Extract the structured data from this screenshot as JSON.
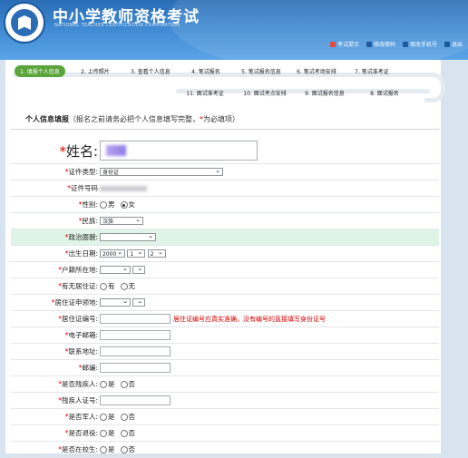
{
  "header": {
    "title": "中小学教师资格考试",
    "subtitle": "NATIONAL TEACHER CERTIFICATION EXAMINATION",
    "links": [
      {
        "label": "考试提示",
        "icon": "alert-icon",
        "color": "#e04a3a"
      },
      {
        "label": "修改密码",
        "icon": "key-icon",
        "color": "#2a6db6"
      },
      {
        "label": "修改手机号",
        "icon": "phone-icon",
        "color": "#2a6db6"
      },
      {
        "label": "退出",
        "icon": "exit-icon",
        "color": "#2a6db6"
      }
    ]
  },
  "steps_row1": [
    {
      "label": "1. 填报个人信息",
      "active": true
    },
    {
      "label": "2. 上传照片",
      "active": false
    },
    {
      "label": "3. 查看个人信息",
      "active": false
    },
    {
      "label": "4. 笔试报名",
      "active": false
    },
    {
      "label": "5. 笔试报名信息",
      "active": false
    },
    {
      "label": "6. 笔试考场安排",
      "active": false
    },
    {
      "label": "7. 笔试准考证",
      "active": false
    }
  ],
  "steps_row2": [
    {
      "label": "11. 面试准考证"
    },
    {
      "label": "10. 面试考点安排"
    },
    {
      "label": "9. 面试报名信息"
    },
    {
      "label": "8. 面试报名"
    }
  ],
  "form_header": {
    "title": "个人信息填报",
    "hint": "（报名之前请务必把个人信息填写完整，",
    "hint_star": "*",
    "hint_end": "为必填项）"
  },
  "fields": {
    "name": {
      "label": "姓名:"
    },
    "id_type": {
      "label": "证件类型:",
      "value": "身份证"
    },
    "id_number": {
      "label": "证件号码"
    },
    "gender": {
      "label": "性别:",
      "options": [
        "男",
        "女"
      ],
      "selected": "女"
    },
    "ethnicity": {
      "label": "民族:",
      "value": "汉族"
    },
    "political": {
      "label": "政治面貌:",
      "value": ""
    },
    "birth": {
      "label": "出生日期:",
      "year": "2000",
      "month": "1",
      "day": "2"
    },
    "hukou": {
      "label": "户籍所在地:"
    },
    "has_permit": {
      "label": "有无居住证:",
      "options": [
        "有",
        "无"
      ]
    },
    "permit_place": {
      "label": "居住证申领地:"
    },
    "permit_no": {
      "label": "居住证编号:",
      "warning": "居住证编号应真实准确，没有编号的直接填写身份证号"
    },
    "email": {
      "label": "电子邮箱:"
    },
    "address": {
      "label": "联系地址:"
    },
    "postcode": {
      "label": "邮编:"
    },
    "disabled": {
      "label": "是否残疾人:",
      "options": [
        "是",
        "否"
      ]
    },
    "disabled_cert": {
      "label": "残疾人证号:"
    },
    "military": {
      "label": "是否军人:",
      "options": [
        "是",
        "否"
      ]
    },
    "retired": {
      "label": "是否退役:",
      "options": [
        "是",
        "否"
      ]
    },
    "student": {
      "label": "是否在校生:",
      "options": [
        "是",
        "否"
      ]
    }
  }
}
